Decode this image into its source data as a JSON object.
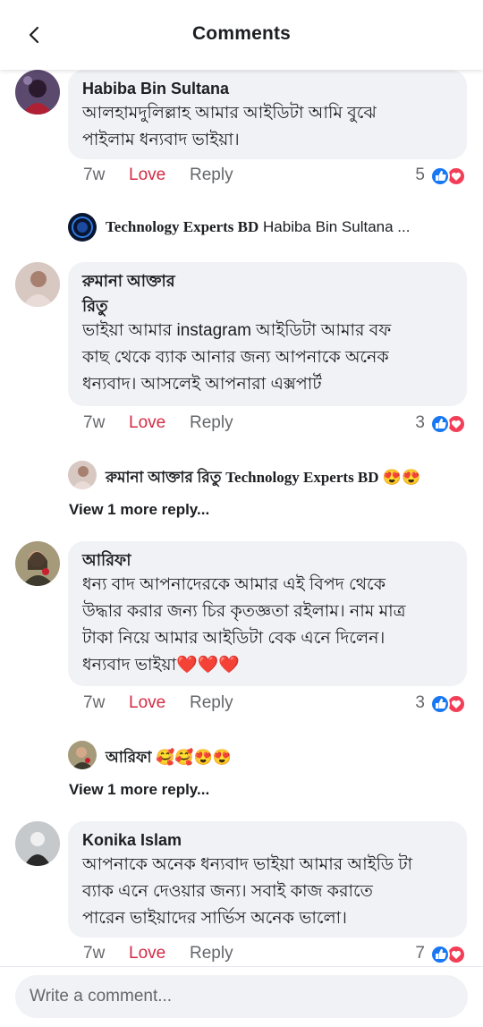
{
  "header": {
    "title": "Comments",
    "back_icon": "chevron-left-icon"
  },
  "comments": [
    {
      "author": "Habiba Bin Sultana",
      "text": "আলহামদুলিল্লাহ আমার আইডিটা আমি বুঝে\nপাইলাম ধন্যবাদ ভাইয়া।",
      "time": "7w",
      "love": "Love",
      "reply": "Reply",
      "reactions": "5"
    },
    {
      "author": "রুমানা আক্তার",
      "author_line2": "রিতু",
      "text": "ভাইয়া আমার instagram আইডিটা আমার বফ\nকাছ থেকে ব্যাক আনার জন্য আপনাকে অনেক\nধন্যবাদ।  আসলেই আপনারা এক্সপার্ট",
      "time": "7w",
      "love": "Love",
      "reply": "Reply",
      "reactions": "3"
    },
    {
      "author": "আরিফা",
      "text": "ধন্য বাদ আপনাদেরকে আমার এই বিপদ থেকে\nউদ্ধার করার জন্য চির কৃতজ্ঞতা রইলাম। নাম মাত্র\nটাকা নিয়ে আমার আইডিটা বেক এনে দিলেন।\nধন্যবাদ ভাইয়া❤️❤️❤️",
      "time": "7w",
      "love": "Love",
      "reply": "Reply",
      "reactions": "3"
    },
    {
      "author": "Konika Islam",
      "text": "আপনাকে অনেক ধন্যবাদ ভাইয়া আমার আইডি টা\nব্যাক এনে দেওয়ার জন্য। সবাই কাজ করাতে\nপারেন ভাইয়াদের সার্ভিস অনেক ভালো।",
      "time": "7w",
      "love": "Love",
      "reply": "Reply",
      "reactions": "7"
    }
  ],
  "replies": [
    {
      "author": "Technology Experts BD",
      "mention": "Habiba Bin Sultana ..."
    },
    {
      "author": "রুমানা আক্তার রিতু",
      "mention": "Technology Experts BD 😍😍"
    },
    {
      "author": "আরিফা",
      "mention": "🥰🥰😍😍"
    }
  ],
  "view_more": [
    "View 1 more reply...",
    "View 1 more reply..."
  ],
  "composer": {
    "placeholder": "Write a comment..."
  },
  "colors": {
    "love": "#d42b45",
    "like_blue": "#1877f2",
    "bubble": "#f0f2f5",
    "meta_gray": "#65676b"
  }
}
